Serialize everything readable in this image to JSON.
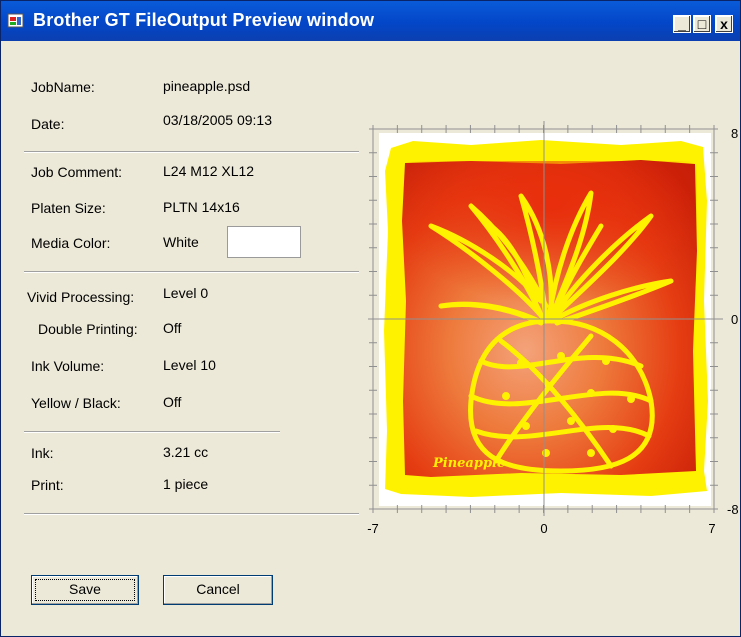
{
  "window": {
    "title": "Brother GT FileOutput Preview window",
    "controls": {
      "minimize": "_",
      "maximize": "□",
      "close": "x"
    }
  },
  "info": {
    "job_name": {
      "label": "JobName:",
      "value": "pineapple.psd"
    },
    "date": {
      "label": "Date:",
      "value": "03/18/2005 09:13"
    },
    "job_comment": {
      "label": "Job Comment:",
      "value": "L24  M12  XL12"
    },
    "platen_size": {
      "label": "Platen Size:",
      "value": "PLTN 14x16"
    },
    "media_color": {
      "label": "Media Color:",
      "value": "White",
      "swatch_color": "#FFFFFF"
    },
    "vivid_processing": {
      "label": "Vivid Processing:",
      "value": "Level 0"
    },
    "double_printing": {
      "label": "Double Printing:",
      "value": "Off"
    },
    "ink_volume": {
      "label": "Ink Volume:",
      "value": "Level 10"
    },
    "yellow_black": {
      "label": "Yellow / Black:",
      "value": "Off"
    },
    "ink": {
      "label": "Ink:",
      "value": "3.21 cc"
    },
    "print": {
      "label": "Print:",
      "value": "1 piece"
    }
  },
  "preview": {
    "x_ticks": [
      "-7",
      "0",
      "7"
    ],
    "y_ticks": [
      "8",
      "0",
      "-8"
    ],
    "artwork_text": "Pineapple",
    "colors": {
      "frame": "#FFF200",
      "center": "#E82A0A",
      "glow": "#F4A27A"
    }
  },
  "buttons": {
    "save": "Save",
    "cancel": "Cancel"
  }
}
